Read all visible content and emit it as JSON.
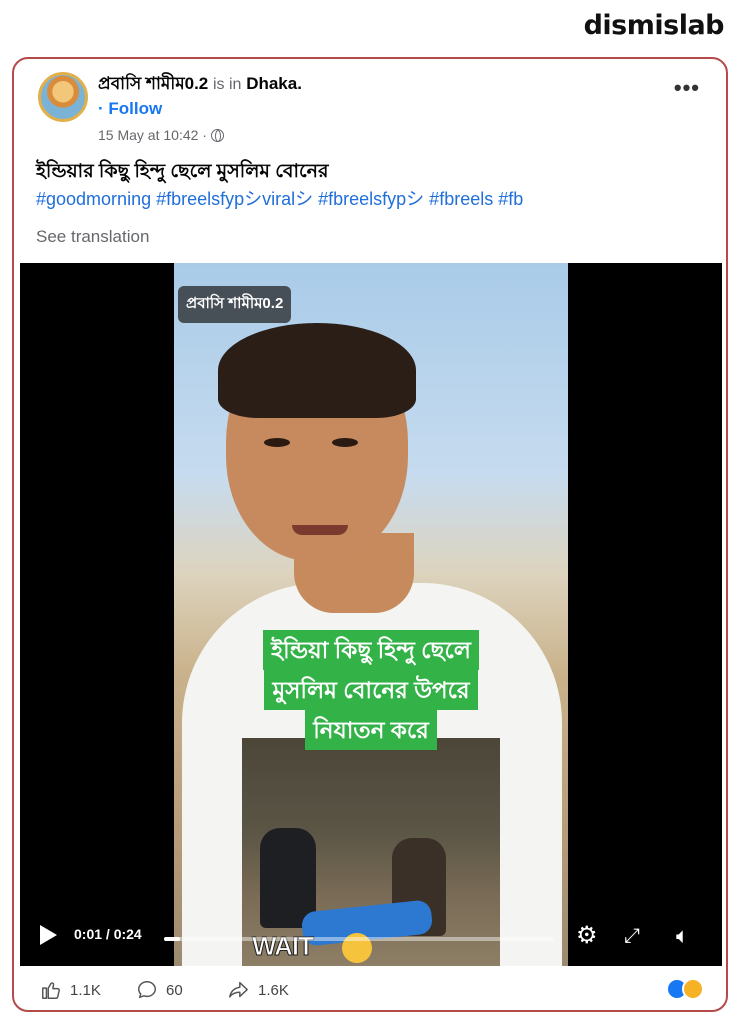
{
  "brand": {
    "name": "dismislab"
  },
  "post": {
    "author": "প্রবাসি শামীম0.2",
    "is_in_label": "is in",
    "location": "Dhaka.",
    "follow_label": "· Follow",
    "timestamp": "15 May at 10:42 ·",
    "caption": "ইন্ডিয়ার কিছু হিন্দু ছেলে মুসলিম বোনের",
    "hashtags": "#goodmorning #fbreelsfypシviralシ #fbreelsfypシ #fbreels #fb",
    "see_translation": "See translation",
    "more_icon": "more-options-icon"
  },
  "video": {
    "watermark": "প্রবাসি শামীম0.2",
    "overlay_lines": [
      "ইন্ডিয়া কিছু হিন্দু ছেলে",
      "মুসলিম বোনের উপরে",
      "নিযাতন করে"
    ],
    "wait_text": "WAIT",
    "time": "0:01 / 0:24",
    "progress": 0.04,
    "icons": {
      "play": "play-icon",
      "settings": "gear-icon",
      "fullscreen": "expand-icon",
      "mute": "mute-icon"
    }
  },
  "footer": {
    "likes": "1.1K",
    "comments": "60",
    "shares": "1.6K",
    "reactions": [
      "like",
      "sad"
    ]
  },
  "colors": {
    "accent": "#1877f2",
    "hashtag": "#216fdb",
    "border": "#b44a4a",
    "overlay_green": "#33b248"
  }
}
